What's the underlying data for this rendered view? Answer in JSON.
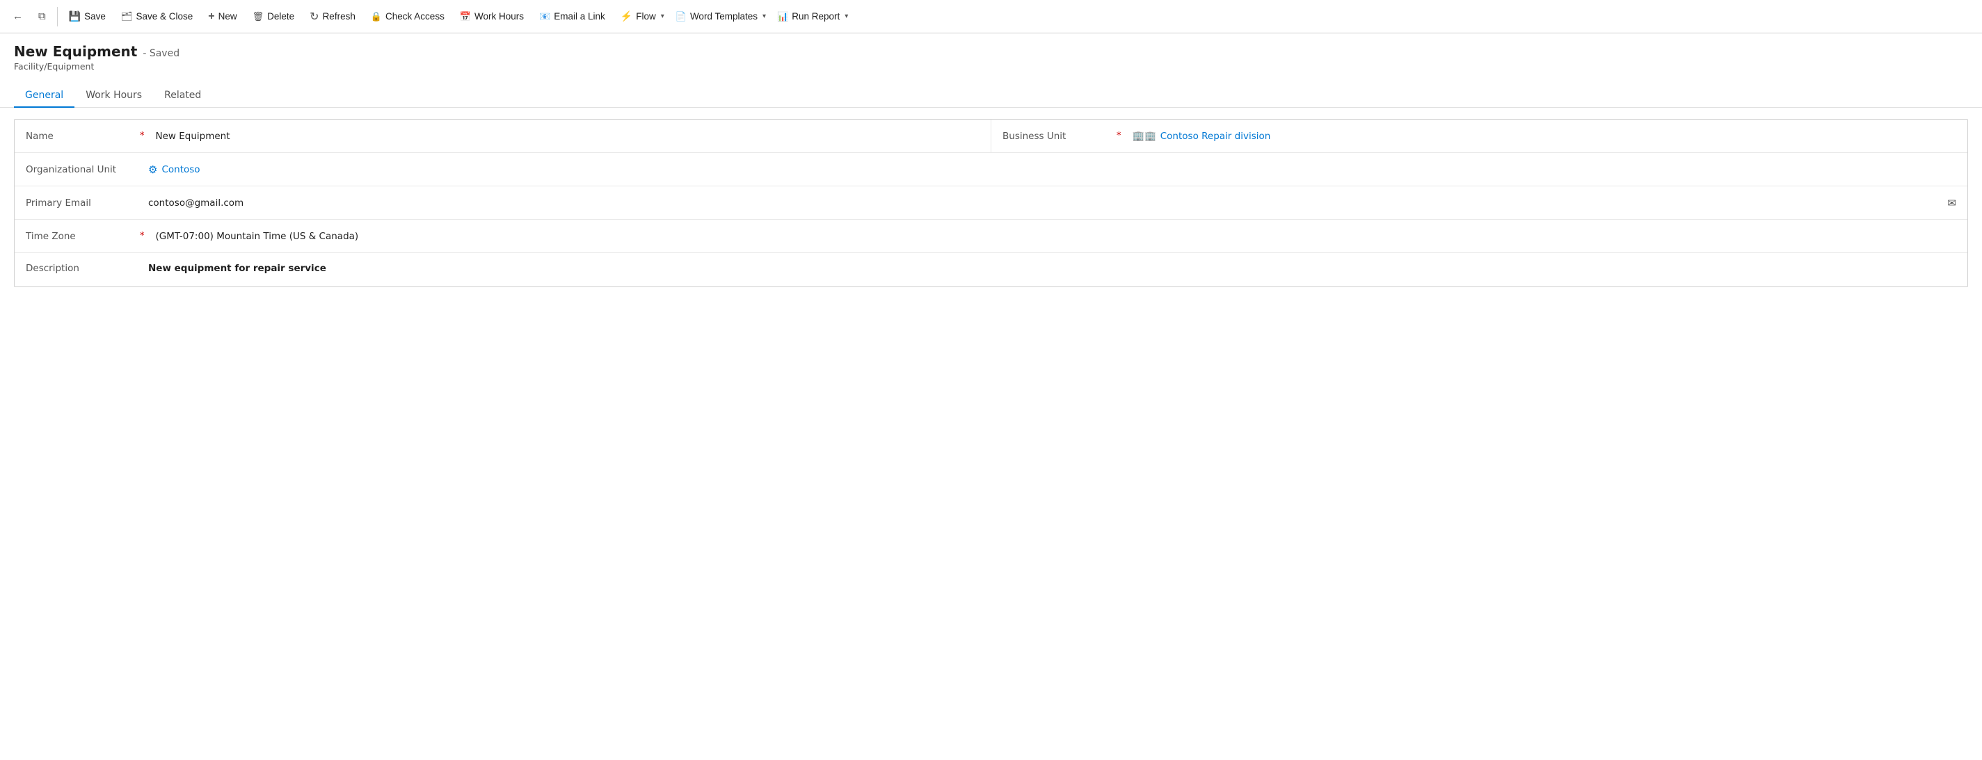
{
  "toolbar": {
    "back_label": "←",
    "window_label": "⧉",
    "save_label": "Save",
    "save_close_label": "Save & Close",
    "new_label": "New",
    "delete_label": "Delete",
    "refresh_label": "Refresh",
    "check_access_label": "Check Access",
    "work_hours_label": "Work Hours",
    "email_link_label": "Email a Link",
    "flow_label": "Flow",
    "word_templates_label": "Word Templates",
    "run_report_label": "Run Report"
  },
  "page": {
    "title": "New Equipment",
    "saved_indicator": "- Saved",
    "subtitle": "Facility/Equipment"
  },
  "tabs": [
    {
      "id": "general",
      "label": "General",
      "active": true
    },
    {
      "id": "work_hours",
      "label": "Work Hours",
      "active": false
    },
    {
      "id": "related",
      "label": "Related",
      "active": false
    }
  ],
  "form": {
    "fields": [
      {
        "label": "Name",
        "required": true,
        "value": "New Equipment",
        "type": "text",
        "side": "left"
      },
      {
        "label": "Business Unit",
        "required": true,
        "value": "Contoso Repair division",
        "type": "link",
        "side": "right"
      },
      {
        "label": "Organizational Unit",
        "required": false,
        "value": "Contoso",
        "type": "org-link",
        "side": "left"
      },
      {
        "label": "Primary Email",
        "required": false,
        "value": "contoso@gmail.com",
        "type": "email",
        "side": "left"
      },
      {
        "label": "Time Zone",
        "required": true,
        "value": "(GMT-07:00) Mountain Time (US & Canada)",
        "type": "text",
        "side": "left"
      },
      {
        "label": "Description",
        "required": false,
        "value": "New equipment for repair service",
        "type": "bold-text",
        "side": "left"
      }
    ]
  }
}
